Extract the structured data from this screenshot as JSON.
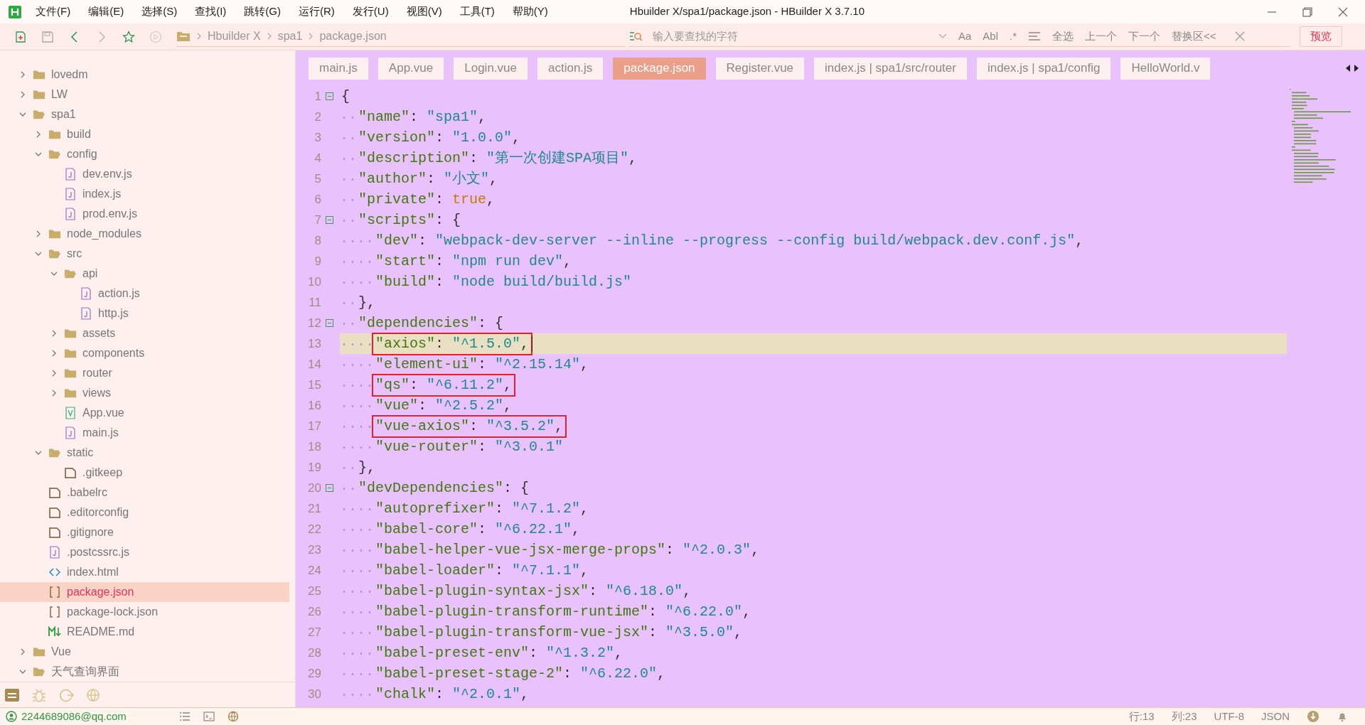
{
  "window": {
    "title": "Hbuilder X/spa1/package.json - HBuilder X 3.7.10"
  },
  "menu": [
    "文件(F)",
    "编辑(E)",
    "选择(S)",
    "查找(I)",
    "跳转(G)",
    "运行(R)",
    "发行(U)",
    "视图(V)",
    "工具(T)",
    "帮助(Y)"
  ],
  "breadcrumb": [
    "Hbuilder X",
    "spa1",
    "package.json"
  ],
  "search": {
    "placeholder": "输入要查找的字符",
    "options": [
      "Aa",
      "Abl",
      ".*"
    ],
    "actions": [
      "全选",
      "上一个",
      "下一个",
      "替换区<<"
    ]
  },
  "preview_button": "预览",
  "sidebar": {
    "items": [
      {
        "label": "lovedm",
        "kind": "folder",
        "expanded": false,
        "selected": false
      },
      {
        "label": "LW",
        "kind": "folder",
        "expanded": false,
        "selected": false
      },
      {
        "label": "spa1",
        "kind": "folder",
        "expanded": true,
        "selected": false,
        "children": [
          {
            "label": "build",
            "kind": "folder",
            "expanded": false,
            "selected": false
          },
          {
            "label": "config",
            "kind": "folder",
            "expanded": true,
            "selected": false,
            "children": [
              {
                "label": "dev.env.js",
                "kind": "js",
                "selected": false
              },
              {
                "label": "index.js",
                "kind": "js",
                "selected": false
              },
              {
                "label": "prod.env.js",
                "kind": "js",
                "selected": false
              }
            ]
          },
          {
            "label": "node_modules",
            "kind": "folder",
            "expanded": false,
            "selected": false
          },
          {
            "label": "src",
            "kind": "folder",
            "expanded": true,
            "selected": false,
            "children": [
              {
                "label": "api",
                "kind": "folder",
                "expanded": true,
                "selected": false,
                "children": [
                  {
                    "label": "action.js",
                    "kind": "js",
                    "selected": false
                  },
                  {
                    "label": "http.js",
                    "kind": "js",
                    "selected": false
                  }
                ]
              },
              {
                "label": "assets",
                "kind": "folder",
                "expanded": false,
                "selected": false
              },
              {
                "label": "components",
                "kind": "folder",
                "expanded": false,
                "selected": false
              },
              {
                "label": "router",
                "kind": "folder",
                "expanded": false,
                "selected": false
              },
              {
                "label": "views",
                "kind": "folder",
                "expanded": false,
                "selected": false
              },
              {
                "label": "App.vue",
                "kind": "vue",
                "selected": false
              },
              {
                "label": "main.js",
                "kind": "js",
                "selected": false
              }
            ]
          },
          {
            "label": "static",
            "kind": "folder",
            "expanded": true,
            "selected": false,
            "children": [
              {
                "label": ".gitkeep",
                "kind": "file",
                "selected": false
              }
            ]
          },
          {
            "label": ".babelrc",
            "kind": "file",
            "selected": false
          },
          {
            "label": ".editorconfig",
            "kind": "file",
            "selected": false
          },
          {
            "label": ".gitignore",
            "kind": "file",
            "selected": false
          },
          {
            "label": ".postcssrc.js",
            "kind": "js",
            "selected": false
          },
          {
            "label": "index.html",
            "kind": "html",
            "selected": false
          },
          {
            "label": "package.json",
            "kind": "json",
            "selected": true
          },
          {
            "label": "package-lock.json",
            "kind": "json",
            "selected": false
          },
          {
            "label": "README.md",
            "kind": "md",
            "selected": false
          }
        ]
      },
      {
        "label": "Vue",
        "kind": "folder",
        "expanded": false,
        "selected": false
      },
      {
        "label": "天气查询界面",
        "kind": "folder",
        "expanded": true,
        "selected": false
      }
    ]
  },
  "tabs": [
    {
      "label": "main.js",
      "selected": false
    },
    {
      "label": "App.vue",
      "selected": false
    },
    {
      "label": "Login.vue",
      "selected": false
    },
    {
      "label": "action.js",
      "selected": false
    },
    {
      "label": "package.json",
      "selected": true
    },
    {
      "label": "Register.vue",
      "selected": false
    },
    {
      "label": "index.js | spa1/src/router",
      "selected": false
    },
    {
      "label": "index.js | spa1/config",
      "selected": false
    },
    {
      "label": "HelloWorld.v",
      "selected": false
    }
  ],
  "editor": {
    "lines": [
      {
        "number": "1",
        "code": "{",
        "foldable": true,
        "current": false,
        "boxed": false
      },
      {
        "number": "2",
        "code": "  \"name\": \"spa1\",",
        "foldable": false,
        "current": false,
        "boxed": false
      },
      {
        "number": "3",
        "code": "  \"version\": \"1.0.0\",",
        "foldable": false,
        "current": false,
        "boxed": false
      },
      {
        "number": "4",
        "code": "  \"description\": \"第一次创建SPA项目\",",
        "foldable": false,
        "current": false,
        "boxed": false
      },
      {
        "number": "5",
        "code": "  \"author\": \"小文\",",
        "foldable": false,
        "current": false,
        "boxed": false
      },
      {
        "number": "6",
        "code": "  \"private\": true,",
        "foldable": false,
        "current": false,
        "boxed": false
      },
      {
        "number": "7",
        "code": "  \"scripts\": {",
        "foldable": true,
        "current": false,
        "boxed": false
      },
      {
        "number": "8",
        "code": "    \"dev\": \"webpack-dev-server --inline --progress --config build/webpack.dev.conf.js\",",
        "foldable": false,
        "current": false,
        "boxed": false
      },
      {
        "number": "9",
        "code": "    \"start\": \"npm run dev\",",
        "foldable": false,
        "current": false,
        "boxed": false
      },
      {
        "number": "10",
        "code": "    \"build\": \"node build/build.js\"",
        "foldable": false,
        "current": false,
        "boxed": false
      },
      {
        "number": "11",
        "code": "  },",
        "foldable": false,
        "current": false,
        "boxed": false
      },
      {
        "number": "12",
        "code": "  \"dependencies\": {",
        "foldable": true,
        "current": false,
        "boxed": false
      },
      {
        "number": "13",
        "code": "    \"axios\": \"^1.5.0\",",
        "foldable": false,
        "current": true,
        "boxed": true
      },
      {
        "number": "14",
        "code": "    \"element-ui\": \"^2.15.14\",",
        "foldable": false,
        "current": false,
        "boxed": false
      },
      {
        "number": "15",
        "code": "    \"qs\": \"^6.11.2\",",
        "foldable": false,
        "current": false,
        "boxed": true
      },
      {
        "number": "16",
        "code": "    \"vue\": \"^2.5.2\",",
        "foldable": false,
        "current": false,
        "boxed": false
      },
      {
        "number": "17",
        "code": "    \"vue-axios\": \"^3.5.2\",",
        "foldable": false,
        "current": false,
        "boxed": true
      },
      {
        "number": "18",
        "code": "    \"vue-router\": \"^3.0.1\"",
        "foldable": false,
        "current": false,
        "boxed": false
      },
      {
        "number": "19",
        "code": "  },",
        "foldable": false,
        "current": false,
        "boxed": false
      },
      {
        "number": "20",
        "code": "  \"devDependencies\": {",
        "foldable": true,
        "current": false,
        "boxed": false
      },
      {
        "number": "21",
        "code": "    \"autoprefixer\": \"^7.1.2\",",
        "foldable": false,
        "current": false,
        "boxed": false
      },
      {
        "number": "22",
        "code": "    \"babel-core\": \"^6.22.1\",",
        "foldable": false,
        "current": false,
        "boxed": false
      },
      {
        "number": "23",
        "code": "    \"babel-helper-vue-jsx-merge-props\": \"^2.0.3\",",
        "foldable": false,
        "current": false,
        "boxed": false
      },
      {
        "number": "24",
        "code": "    \"babel-loader\": \"^7.1.1\",",
        "foldable": false,
        "current": false,
        "boxed": false
      },
      {
        "number": "25",
        "code": "    \"babel-plugin-syntax-jsx\": \"^6.18.0\",",
        "foldable": false,
        "current": false,
        "boxed": false
      },
      {
        "number": "26",
        "code": "    \"babel-plugin-transform-runtime\": \"^6.22.0\",",
        "foldable": false,
        "current": false,
        "boxed": false
      },
      {
        "number": "27",
        "code": "    \"babel-plugin-transform-vue-jsx\": \"^3.5.0\",",
        "foldable": false,
        "current": false,
        "boxed": false
      },
      {
        "number": "28",
        "code": "    \"babel-preset-env\": \"^1.3.2\",",
        "foldable": false,
        "current": false,
        "boxed": false
      },
      {
        "number": "29",
        "code": "    \"babel-preset-stage-2\": \"^6.22.0\",",
        "foldable": false,
        "current": false,
        "boxed": false
      },
      {
        "number": "30",
        "code": "    \"chalk\": \"^2.0.1\",",
        "foldable": false,
        "current": false,
        "boxed": false
      }
    ]
  },
  "status_bar": {
    "account": "2244689086@qq.com",
    "line": "行:13",
    "column": "列:23",
    "encoding": "UTF-8",
    "language": "JSON"
  }
}
